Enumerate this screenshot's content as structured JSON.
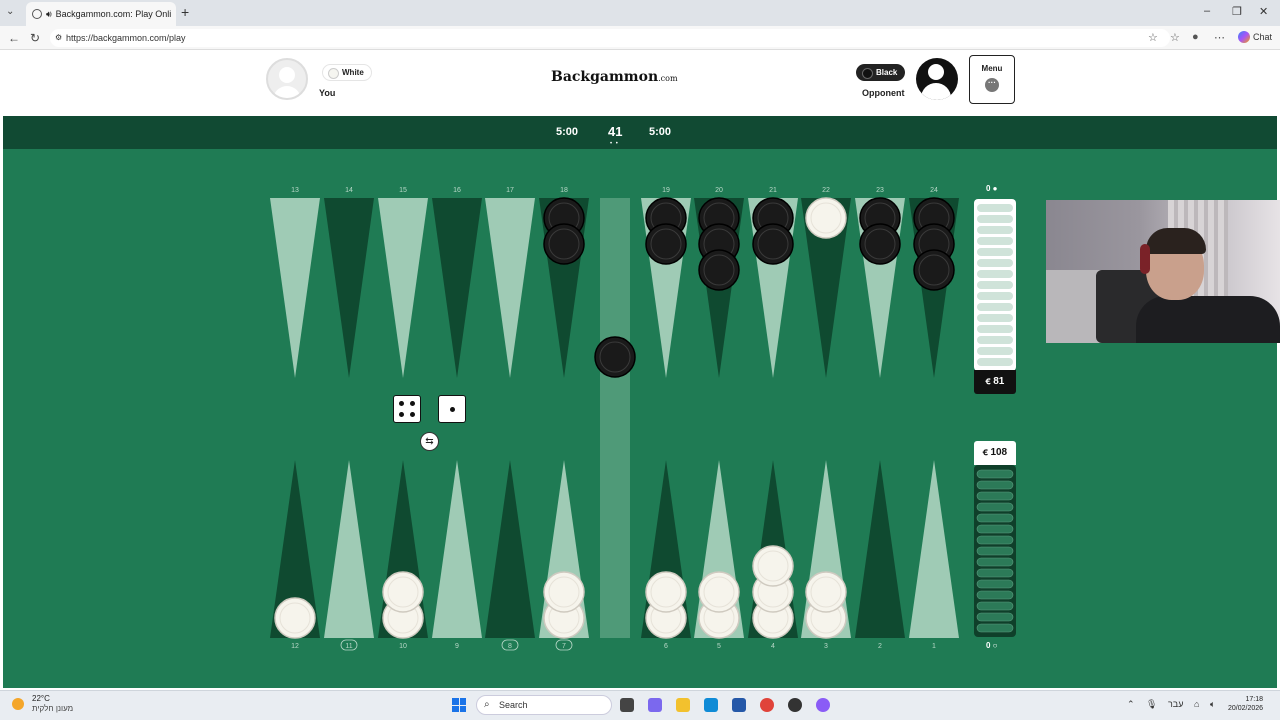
{
  "browser": {
    "tab_title": "Backgammon.com: Play Onli",
    "url": "https://backgammon.com/play",
    "chat_label": "Chat"
  },
  "header": {
    "brand": "Backgammon",
    "brand_suffix": ".com",
    "you": {
      "color_label": "White",
      "name": "You"
    },
    "opponent": {
      "color_label": "Black",
      "name": "Opponent"
    },
    "menu_label": "Menu"
  },
  "game": {
    "timer_left": "5:00",
    "move_count": "41",
    "timer_right": "5:00",
    "top_point_numbers": [
      "13",
      "14",
      "15",
      "16",
      "17",
      "18",
      "19",
      "20",
      "21",
      "22",
      "23",
      "24"
    ],
    "bottom_point_numbers": [
      "12",
      "11",
      "10",
      "9",
      "8",
      "7",
      "6",
      "5",
      "4",
      "3",
      "2",
      "1"
    ],
    "highlighted_points": [
      "11",
      "8",
      "7"
    ],
    "dice": [
      4,
      1
    ],
    "pip_black": "81",
    "pip_white": "108",
    "pip_prefix": "‏c",
    "borne_off_black": "0",
    "borne_off_white": "0",
    "checkers": {
      "18": {
        "color": "black",
        "count": 2
      },
      "19": {
        "color": "black",
        "count": 2
      },
      "20": {
        "color": "black",
        "count": 3
      },
      "21": {
        "color": "black",
        "count": 2
      },
      "22": {
        "color": "white",
        "count": 1
      },
      "23": {
        "color": "black",
        "count": 2
      },
      "24": {
        "color": "black",
        "count": 3
      },
      "12": {
        "color": "white",
        "count": 1
      },
      "10": {
        "color": "white",
        "count": 2
      },
      "7": {
        "color": "white",
        "count": 2
      },
      "6": {
        "color": "white",
        "count": 2
      },
      "5": {
        "color": "white",
        "count": 2
      },
      "4": {
        "color": "white",
        "count": 3
      },
      "3": {
        "color": "white",
        "count": 2
      }
    },
    "bar": {
      "black": 1,
      "white": 0
    },
    "colors": {
      "felt": "#1f7b54",
      "dark_point": "#0f4a30",
      "light_point": "#9fcbb5",
      "bar": "#4f9a78"
    }
  },
  "taskbar": {
    "temperature": "22°C",
    "weather_desc": "מעונן חלקית",
    "search_label": "Search",
    "lang": "עבר",
    "time": "17:18",
    "date": "20/02/2026"
  }
}
